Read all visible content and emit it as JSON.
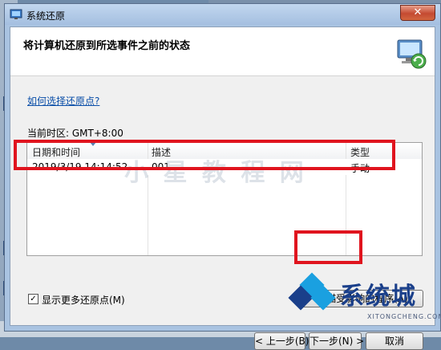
{
  "window": {
    "title": "系统还原",
    "close_label": "✕",
    "header": "将计算机还原到所选事件之前的状态"
  },
  "help_link": "如何选择还原点?",
  "timezone": "当前时区: GMT+8:00",
  "table": {
    "columns": [
      "日期和时间",
      "描述",
      "类型"
    ],
    "rows": [
      {
        "datetime": "2019/3/19 14:14:52",
        "description": "001",
        "type": "手动"
      }
    ]
  },
  "show_more": {
    "label": "显示更多还原点(M)",
    "checked": true,
    "check_glyph": "✓"
  },
  "buttons": {
    "scan": "扫描受影响的程序(A)",
    "back": "< 上一步(B)",
    "next": "下一步(N) >",
    "cancel": "取消"
  },
  "watermarks": {
    "middle": "小 星 教 程 网",
    "brand": "系统城",
    "brand_sub": "XITONGCHENG.COM"
  },
  "colors": {
    "highlight_red": "#e0141e",
    "link_blue": "#0a4ea8",
    "brand_blue": "#1a3f8a",
    "brand_cyan": "#1aa0e0"
  }
}
